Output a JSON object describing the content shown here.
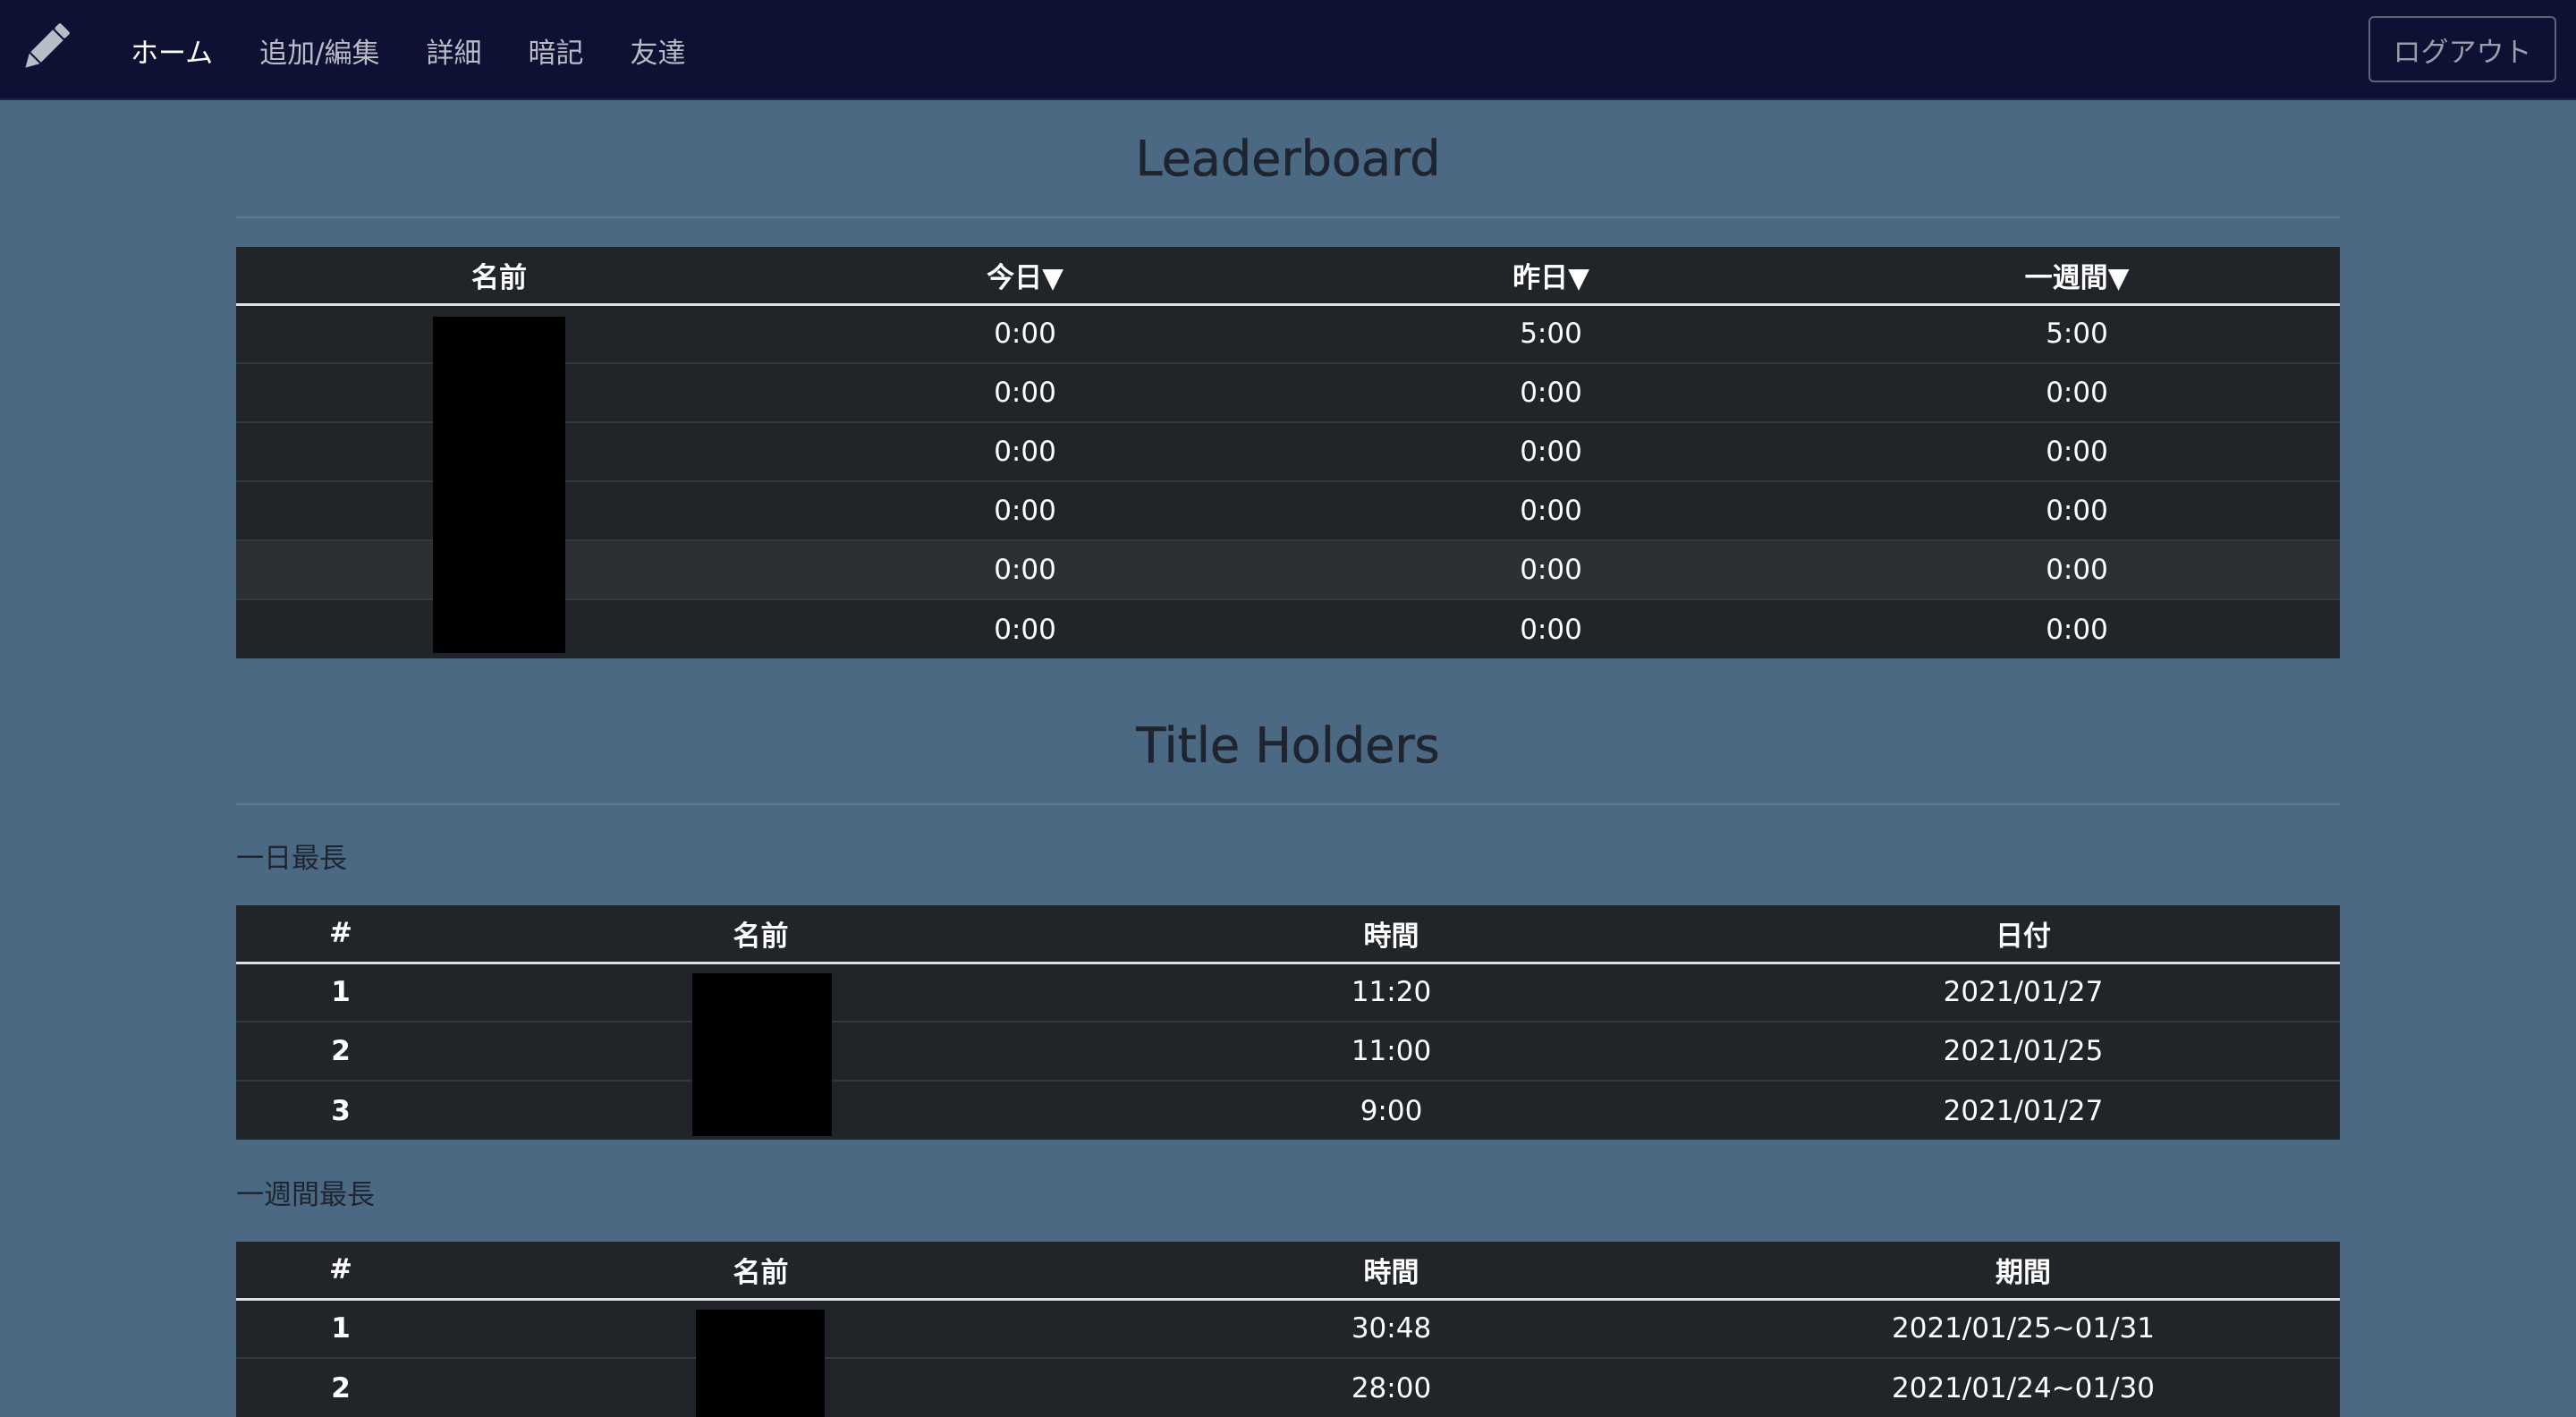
{
  "nav": {
    "brand_icon": "pencil-icon",
    "links": [
      "ホーム",
      "追加/編集",
      "詳細",
      "暗記",
      "友達"
    ],
    "active": "ホーム",
    "logout_label": "ログアウト"
  },
  "leaderboard": {
    "title": "Leaderboard",
    "headers": [
      "名前",
      "今日▼",
      "昨日▼",
      "一週間▼"
    ],
    "rows": [
      [
        "",
        "0:00",
        "5:00",
        "5:00"
      ],
      [
        "",
        "0:00",
        "0:00",
        "0:00"
      ],
      [
        "",
        "0:00",
        "0:00",
        "0:00"
      ],
      [
        "",
        "0:00",
        "0:00",
        "0:00"
      ],
      [
        "",
        "0:00",
        "0:00",
        "0:00"
      ],
      [
        "",
        "0:00",
        "0:00",
        "0:00"
      ]
    ]
  },
  "title_holders": {
    "title": "Title Holders",
    "daily": {
      "label": "一日最長",
      "headers": [
        "#",
        "名前",
        "時間",
        "日付"
      ],
      "rows": [
        [
          "1",
          "",
          "11:20",
          "2021/01/27"
        ],
        [
          "2",
          "",
          "11:00",
          "2021/01/25"
        ],
        [
          "3",
          "",
          "9:00",
          "2021/01/27"
        ]
      ]
    },
    "weekly": {
      "label": "一週間最長",
      "headers": [
        "#",
        "名前",
        "時間",
        "期間"
      ],
      "rows": [
        [
          "1",
          "",
          "30:48",
          "2021/01/25~01/31"
        ],
        [
          "2",
          "",
          "28:00",
          "2021/01/24~01/30"
        ]
      ]
    }
  }
}
